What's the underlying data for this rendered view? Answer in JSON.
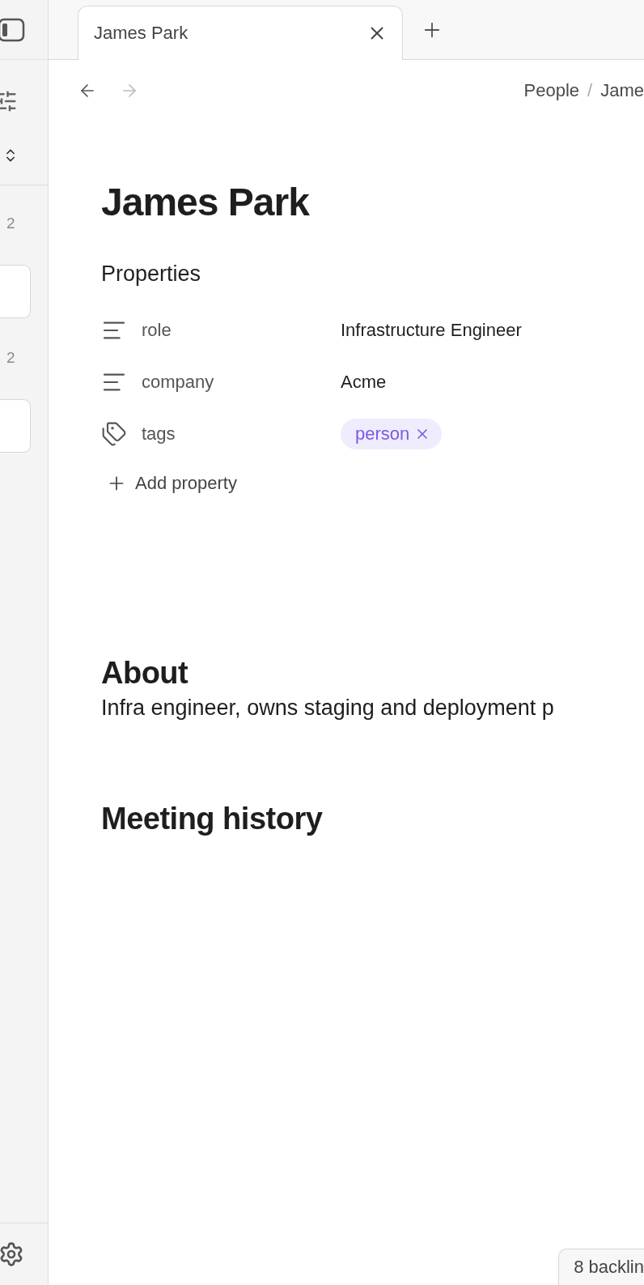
{
  "sidebar": {
    "items": [
      {
        "kind": "count",
        "text": "2"
      },
      {
        "kind": "card"
      },
      {
        "kind": "count",
        "text": "2"
      },
      {
        "kind": "card"
      }
    ]
  },
  "tabs": [
    {
      "label": "James Park",
      "selected": true
    }
  ],
  "nav": {
    "back_disabled": false,
    "forward_disabled": true
  },
  "breadcrumb": {
    "separator": "/",
    "items": [
      "People",
      "Jame"
    ]
  },
  "title": "James Park",
  "properties": {
    "heading": "Properties",
    "rows": [
      {
        "kind": "text",
        "label": "role",
        "value": "Infrastructure Engineer"
      },
      {
        "kind": "text",
        "label": "company",
        "value": "Acme"
      },
      {
        "kind": "tags",
        "label": "tags",
        "tags": [
          "person"
        ]
      }
    ],
    "add_label": "Add property"
  },
  "sections": [
    {
      "heading": "About",
      "body": "Infra engineer, owns staging and deployment p"
    },
    {
      "heading": "Meeting history"
    }
  ],
  "backlinks": "8 backlin"
}
